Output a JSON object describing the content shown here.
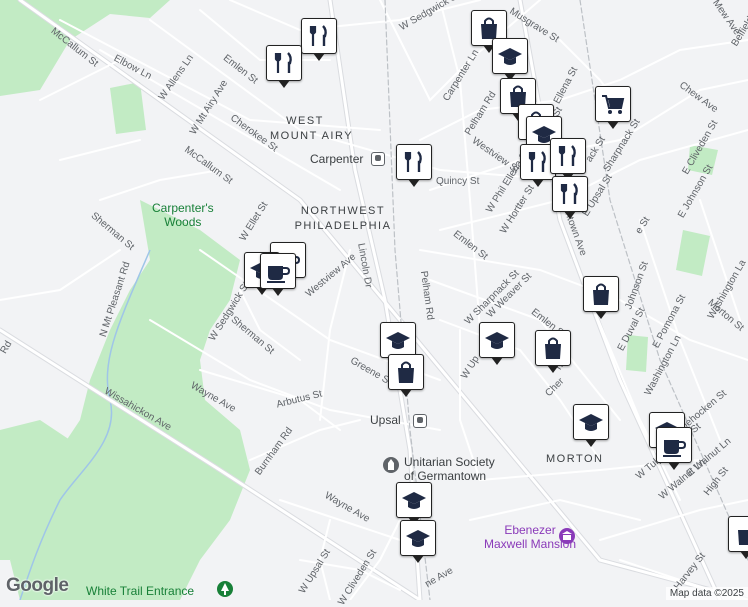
{
  "streets": {
    "w_sedgwick_top": "W Sedgwick St",
    "musgrave": "Musgrave St",
    "mew_ave": "Mew Ave",
    "belfield": "Belfield Ave",
    "mccallum_top": "McCallum St",
    "elbow": "Elbow Ln",
    "w_allens": "W Allens Ln",
    "emlen_top": "Emlen St",
    "w_mt_airy": "W Mt Airy Ave",
    "cherokee": "Cherokee St",
    "mccallum_mid": "McCallum St",
    "carpenter_ln": "Carpenter Ln",
    "pelham_rd_top": "Pelham Rd",
    "ellena": "Ellena St",
    "chew": "Chew Ave",
    "e_cliveden": "E Cliveden St",
    "quincy": "Quincy St",
    "westview_st": "Westview St",
    "w_phil_ellena": "W Phil Ellena St",
    "w_hortter": "W Hortter St",
    "sharpnack_top": "Sharpnack St",
    "e_upsal": "E Upsal St",
    "e_johnson": "E Johnson St",
    "germantown": "Germantown Ave",
    "w_ellet": "W Ellet St",
    "sherman_left": "Sherman St",
    "n_mt_pleasant": "N Mt Pleasant Rd",
    "lincoln": "Lincoln Dr",
    "westview_ave": "Westview Ave",
    "pelham_rd": "Pelham Rd",
    "emlen_mid": "Emlen St",
    "w_sharpnack": "W Sharpnack St",
    "w_weaver": "W Weaver St",
    "johnson": "Johnson St",
    "washington": "Washington La",
    "w_sedgwick_left": "W Sedgwick St",
    "sherman_mid": "Sherman St",
    "rd": "Rd",
    "e_duval": "E Duval St",
    "e_pomona": "E Pomona St",
    "morton_st": "Morton St",
    "washington_ln": "Washington Ln",
    "emlen_lower": "Emlen St",
    "w_upsal_mid": "W Up",
    "greene": "Greene St",
    "wayne_left": "Wayne Ave",
    "arbutus": "Arbutus St",
    "e_tulpehocken": "E Tulpehocken St",
    "w_tulpehocken": "W Tulpehocken St",
    "e_walnut": "E Walnut Ln",
    "w_walnut": "W Walnut Ln",
    "high": "High St",
    "wissahickon": "Wissahickon Ave",
    "burnham": "Burnham Rd",
    "wayne_lower": "Wayne Ave",
    "w_upsal_lower": "W Upsal St",
    "w_cliveden": "W Cliveden St",
    "harvey": "Harvey St",
    "ne_ave": "ne Ave",
    "n_st": "n St",
    "cher": "Cher",
    "e_st": "e St",
    "ack_st": "ack St",
    "man_st": "man St"
  },
  "areas": {
    "west_mount_airy": "WEST\nMOUNT AIRY",
    "northwest_philadelphia": "NORTHWEST\nPHILADELPHIA",
    "morton": "MORTON"
  },
  "pois": {
    "carpenter_station": "Carpenter",
    "carpenters_woods": "Carpenter's\nWoods",
    "upsal_station": "Upsal",
    "unitarian": "Unitarian Society\nof Germantown",
    "ebenezer": "Ebenezer\nMaxwell Mansion",
    "white_trail": "White Trail Entrance"
  },
  "footer": {
    "logo": "Google",
    "attribution": "Map data ©2025"
  },
  "colors": {
    "background": "#f2f3f5",
    "road": "#ffffff",
    "road_casing": "#dadce0",
    "arterial": "#f8f9fa",
    "park": "#c2ebc4",
    "park_label": "#188038",
    "historic_label": "#8a3ab9",
    "marker_icon": "#1f2a44",
    "marker_border": "#222222"
  },
  "markers": [
    {
      "name": "restaurant-marker",
      "icon": "fork-knife-icon"
    },
    {
      "name": "restaurant-marker",
      "icon": "fork-knife-icon"
    },
    {
      "name": "shopping-marker",
      "icon": "shopping-bag-icon"
    },
    {
      "name": "school-marker",
      "icon": "graduation-cap-icon"
    },
    {
      "name": "shopping-marker",
      "icon": "shopping-bag-icon"
    },
    {
      "name": "shopping-cart-marker",
      "icon": "shopping-cart-icon"
    },
    {
      "name": "shopping-marker",
      "icon": "shopping-bag-icon"
    },
    {
      "name": "school-marker",
      "icon": "graduation-cap-icon"
    },
    {
      "name": "restaurant-marker",
      "icon": "fork-knife-icon"
    },
    {
      "name": "restaurant-marker",
      "icon": "fork-knife-icon"
    },
    {
      "name": "restaurant-marker",
      "icon": "fork-knife-icon"
    },
    {
      "name": "restaurant-marker",
      "icon": "fork-knife-icon"
    },
    {
      "name": "cafe-marker",
      "icon": "coffee-cup-icon"
    },
    {
      "name": "school-marker",
      "icon": "graduation-cap-icon"
    },
    {
      "name": "cafe-marker",
      "icon": "coffee-cup-icon"
    },
    {
      "name": "shopping-marker",
      "icon": "shopping-bag-icon"
    },
    {
      "name": "school-marker",
      "icon": "graduation-cap-icon"
    },
    {
      "name": "shopping-marker",
      "icon": "shopping-bag-icon"
    },
    {
      "name": "school-marker",
      "icon": "graduation-cap-icon"
    },
    {
      "name": "shopping-marker",
      "icon": "shopping-bag-icon"
    },
    {
      "name": "school-marker",
      "icon": "graduation-cap-icon"
    },
    {
      "name": "school-marker",
      "icon": "graduation-cap-icon"
    },
    {
      "name": "cafe-marker",
      "icon": "coffee-cup-icon"
    },
    {
      "name": "school-marker",
      "icon": "graduation-cap-icon"
    },
    {
      "name": "school-marker",
      "icon": "graduation-cap-icon"
    },
    {
      "name": "partial-marker",
      "icon": "unknown-icon"
    }
  ]
}
